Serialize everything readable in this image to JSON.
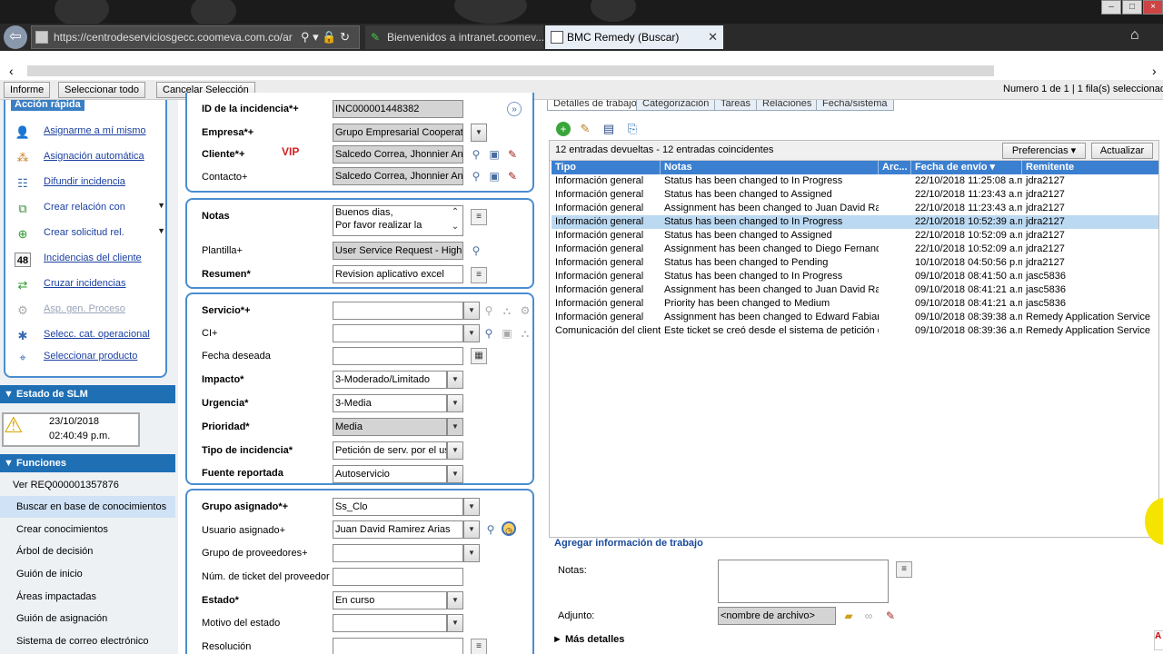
{
  "browser": {
    "url": "https://centrodeserviciosgecc.coomeva.com.co/ar",
    "tabs": [
      {
        "label": "Bienvenidos a intranet.coomev..."
      },
      {
        "label": "BMC Remedy (Buscar)"
      }
    ]
  },
  "toolbar": {
    "buttons": [
      "Informe",
      "Seleccionar todo",
      "Cancelar Selección"
    ],
    "record_info": "Numero 1 de 1 | 1 fila(s) seleccionada"
  },
  "quick_actions": {
    "title": "Acción rápida",
    "items": [
      {
        "label": "Asignarme a mí mismo",
        "icon": "user-assign-icon"
      },
      {
        "label": "Asignación automática",
        "icon": "auto-assign-icon"
      },
      {
        "label": "Difundir incidencia",
        "icon": "broadcast-icon"
      },
      {
        "label": "Crear relación con",
        "icon": "relation-icon"
      },
      {
        "label": "Crear solicitud rel.",
        "icon": "request-icon"
      },
      {
        "label": "Incidencias del cliente",
        "icon": "count-icon",
        "icon_text": "48"
      },
      {
        "label": "Cruzar incidencias",
        "icon": "cross-incident-icon"
      },
      {
        "label": "Asp. gen. Proceso",
        "icon": "process-icon"
      },
      {
        "label": "Selecc. cat. operacional",
        "icon": "category-icon"
      },
      {
        "label": "Seleccionar producto",
        "icon": "product-icon"
      }
    ]
  },
  "slm": {
    "title": "Estado de SLM",
    "date": "23/10/2018",
    "time": "02:40:49 p.m."
  },
  "functions": {
    "title": "Funciones",
    "items": [
      "Ver REQ000001357876",
      "Buscar en base de conocimientos",
      "Crear conocimientos",
      "Árbol de decisión",
      "Guión de inicio",
      "Áreas impactadas",
      "Guión de asignación",
      "Sistema de correo electrónico"
    ]
  },
  "form": {
    "incident_id_label": "ID de la incidencia*+",
    "incident_id": "INC000001448382",
    "company_label": "Empresa*+",
    "company": "Grupo Empresarial Cooperativ",
    "client_label": "Cliente*+",
    "client": "Salcedo Correa, Jhonnier Andr",
    "vip": "VIP",
    "contact_label": "Contacto+",
    "contact": "Salcedo Correa, Jhonnier Andr",
    "notes_label": "Notas",
    "notes_line1": "Buenos dias,",
    "notes_line2": "Por favor realizar la",
    "template_label": "Plantilla+",
    "template": "User Service Request - High",
    "summary_label": "Resumen*",
    "summary": "Revision aplicativo excel",
    "service_label": "Servicio*+",
    "service": "",
    "ci_label": "CI+",
    "ci": "",
    "desired_date_label": "Fecha deseada",
    "desired_date": "",
    "impact_label": "Impacto*",
    "impact": "3-Moderado/Limitado",
    "urgency_label": "Urgencia*",
    "urgency": "3-Media",
    "priority_label": "Prioridad*",
    "priority": "Media",
    "incident_type_label": "Tipo de incidencia*",
    "incident_type": "Petición de serv. por el us",
    "source_label": "Fuente reportada",
    "source": "Autoservicio",
    "group_label": "Grupo asignado*+",
    "group": "Ss_Clo",
    "user_label": "Usuario asignado+",
    "user": "Juan David Ramirez Arias",
    "vendor_group_label": "Grupo de proveedores+",
    "vendor_group": "",
    "vendor_ticket_label": "Núm. de ticket del proveedor",
    "vendor_ticket": "",
    "status_label": "Estado*",
    "status": "En curso",
    "status_reason_label": "Motivo del estado",
    "status_reason": "",
    "resolution_label": "Resolución",
    "resolution": ""
  },
  "right_tabs": [
    "Detalles de trabajo",
    "Categorización",
    "Tareas",
    "Relaciones",
    "Fecha/sistema"
  ],
  "grid": {
    "count_text": "12 entradas devueltas - 12 entradas coincidentes",
    "preferences": "Preferencias",
    "update": "Actualizar",
    "columns": [
      "Tipo",
      "Notas",
      "Arc...",
      "Fecha de envío",
      "Remitente"
    ],
    "rows": [
      {
        "tipo": "Información general",
        "notas": "Status has been changed to In Progress",
        "fecha": "22/10/2018 11:25:08 a.m",
        "remitente": "jdra2127",
        "selected": false
      },
      {
        "tipo": "Información general",
        "notas": "Status has been changed to Assigned",
        "fecha": "22/10/2018 11:23:43 a.m",
        "remitente": "jdra2127",
        "selected": false
      },
      {
        "tipo": "Información general",
        "notas": "Assignment has been changed to Juan David Ram",
        "fecha": "22/10/2018 11:23:43 a.m",
        "remitente": "jdra2127",
        "selected": false
      },
      {
        "tipo": "Información general",
        "notas": "Status has been changed to In Progress",
        "fecha": "22/10/2018 10:52:39 a.m",
        "remitente": "jdra2127",
        "selected": true
      },
      {
        "tipo": "Información general",
        "notas": "Status has been changed to Assigned",
        "fecha": "22/10/2018 10:52:09 a.m",
        "remitente": "jdra2127",
        "selected": false
      },
      {
        "tipo": "Información general",
        "notas": "Assignment has been changed to Diego Fernando",
        "fecha": "22/10/2018 10:52:09 a.m",
        "remitente": "jdra2127",
        "selected": false
      },
      {
        "tipo": "Información general",
        "notas": "Status has been changed to Pending",
        "fecha": "10/10/2018 04:50:56 p.m",
        "remitente": "jdra2127",
        "selected": false
      },
      {
        "tipo": "Información general",
        "notas": "Status has been changed to In Progress",
        "fecha": "09/10/2018 08:41:50 a.m",
        "remitente": "jasc5836",
        "selected": false
      },
      {
        "tipo": "Información general",
        "notas": "Assignment has been changed to Juan David Ram",
        "fecha": "09/10/2018 08:41:21 a.m",
        "remitente": "jasc5836",
        "selected": false
      },
      {
        "tipo": "Información general",
        "notas": "Priority has been changed to Medium",
        "fecha": "09/10/2018 08:41:21 a.m",
        "remitente": "jasc5836",
        "selected": false
      },
      {
        "tipo": "Información general",
        "notas": "Assignment has been changed to Edward Fabian F",
        "fecha": "09/10/2018 08:39:38 a.m",
        "remitente": "Remedy Application Service",
        "selected": false
      },
      {
        "tipo": "Comunicación del cliente",
        "notas": "Este ticket se creó desde el sistema de petición de",
        "fecha": "09/10/2018 08:39:36 a.m",
        "remitente": "Remedy Application Service",
        "selected": false
      }
    ]
  },
  "work_info": {
    "title": "Agregar información de trabajo",
    "notes_label": "Notas:",
    "attachment_label": "Adjunto:",
    "attachment_placeholder": "<nombre de archivo>",
    "more_details": "Más detalles"
  }
}
